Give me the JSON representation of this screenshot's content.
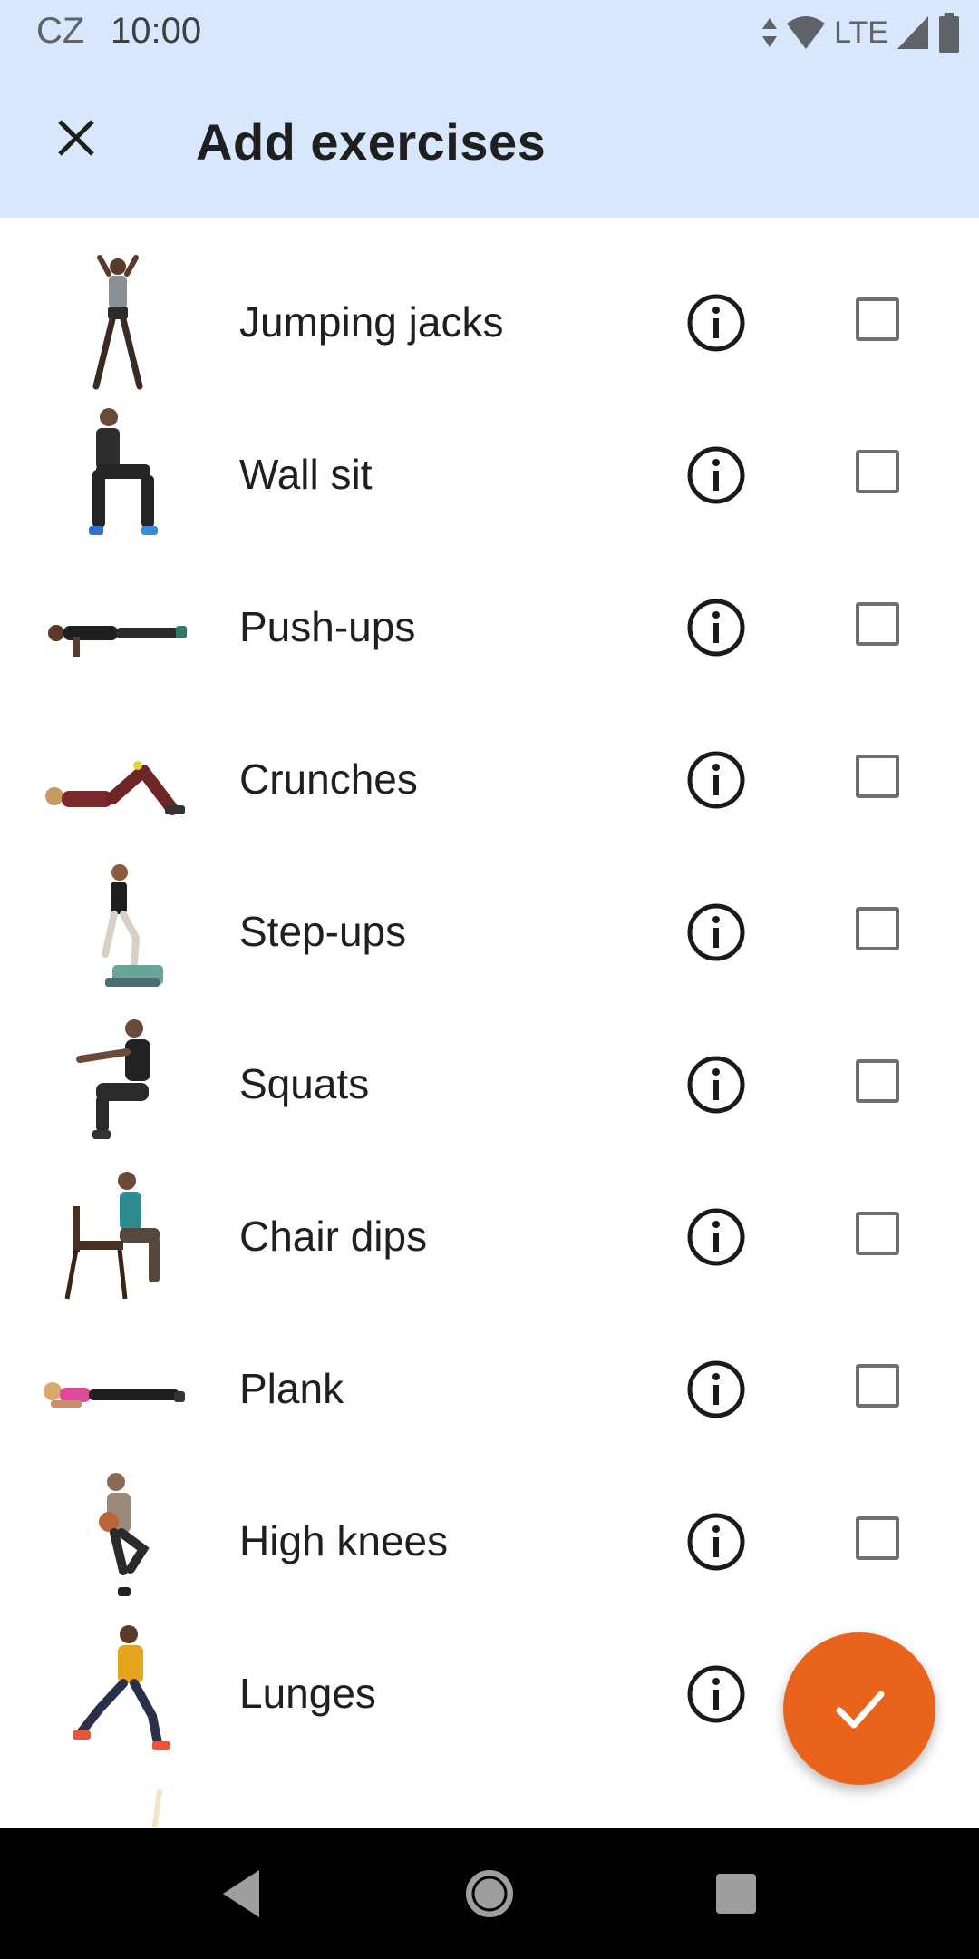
{
  "status_bar": {
    "carrier": "CZ",
    "time": "10:00",
    "network": "LTE"
  },
  "app_bar": {
    "title": "Add exercises",
    "close_icon": "close-icon"
  },
  "exercises": [
    {
      "label": "Jumping jacks",
      "checked": false
    },
    {
      "label": "Wall sit",
      "checked": false
    },
    {
      "label": "Push-ups",
      "checked": false
    },
    {
      "label": "Crunches",
      "checked": false
    },
    {
      "label": "Step-ups",
      "checked": false
    },
    {
      "label": "Squats",
      "checked": false
    },
    {
      "label": "Chair dips",
      "checked": false
    },
    {
      "label": "Plank",
      "checked": false
    },
    {
      "label": "High knees",
      "checked": false
    },
    {
      "label": "Lunges",
      "checked": false
    }
  ],
  "fab": {
    "icon": "check-icon"
  },
  "colors": {
    "app_bar_bg": "#d8e7fb",
    "fab_bg": "#e8631c",
    "checkbox_border": "#6e6e6e",
    "nav_bar_bg": "#000000"
  },
  "nav_bar": {
    "back_icon": "back-icon",
    "home_icon": "home-icon",
    "recents_icon": "recents-icon"
  }
}
